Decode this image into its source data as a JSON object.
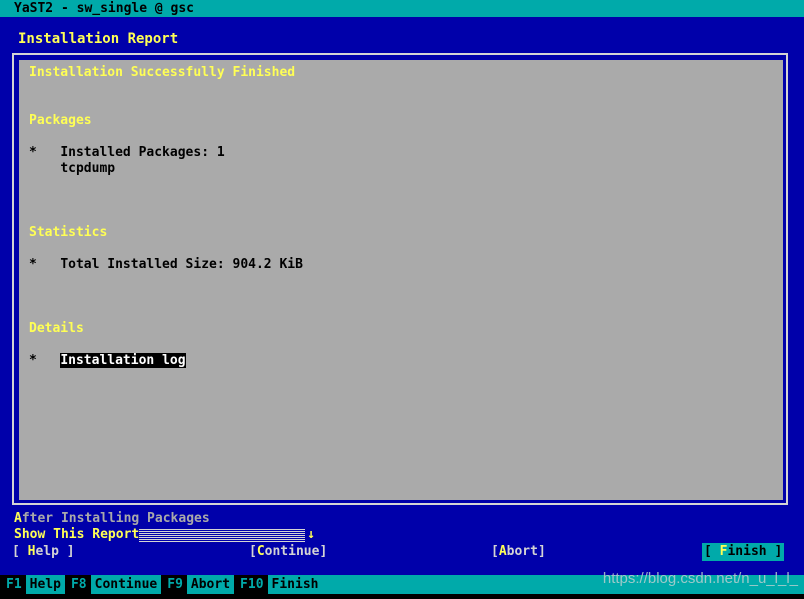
{
  "window": {
    "titlebar": "YaST2 - sw_single @ gsc",
    "dialog_heading": "Installation Report"
  },
  "report": {
    "status_heading": "Installation Successfully Finished",
    "sections": [
      {
        "heading": "Packages",
        "bullet_marker": "*",
        "bullet_text": "Installed Packages: 1",
        "sub_text": "tcpdump"
      },
      {
        "heading": "Statistics",
        "bullet_marker": "*",
        "bullet_text": "Total Installed Size: 904.2 KiB"
      },
      {
        "heading": "Details",
        "bullet_marker": "*",
        "link_text": "Installation log"
      }
    ]
  },
  "options": {
    "group_label_hotkey": "A",
    "group_label_rest": "fter Installing Packages",
    "combo_label": "Show This Report",
    "combo_value": "",
    "combo_arrow": "↓"
  },
  "buttons": {
    "help": {
      "open": "[ ",
      "hotkey": "H",
      "rest": "elp",
      "close": " ]"
    },
    "continue": {
      "open": "[",
      "hotkey": "C",
      "rest": "ontinue",
      "close": "]"
    },
    "abort": {
      "open": "[",
      "hotkey": "A",
      "rest": "bort",
      "close": "]"
    },
    "finish": {
      "open": "[ ",
      "hotkey": "F",
      "rest": "inish",
      "close": " ]"
    }
  },
  "function_keys": [
    {
      "key": "F1",
      "label": "Help"
    },
    {
      "key": "F8",
      "label": "Continue"
    },
    {
      "key": "F9",
      "label": "Abort"
    },
    {
      "key": "F10",
      "label": "Finish"
    }
  ],
  "watermark": "https://blog.csdn.net/n_u_l_l_",
  "colors": {
    "background_blue": "#0000aa",
    "titlebar_cyan": "#00aaaa",
    "panel_gray": "#aaaaaa",
    "heading_yellow": "#ffff55",
    "text_white": "#d4d4d4",
    "text_black": "#000000",
    "link_bg": "#000000",
    "link_fg": "#ffffff"
  }
}
